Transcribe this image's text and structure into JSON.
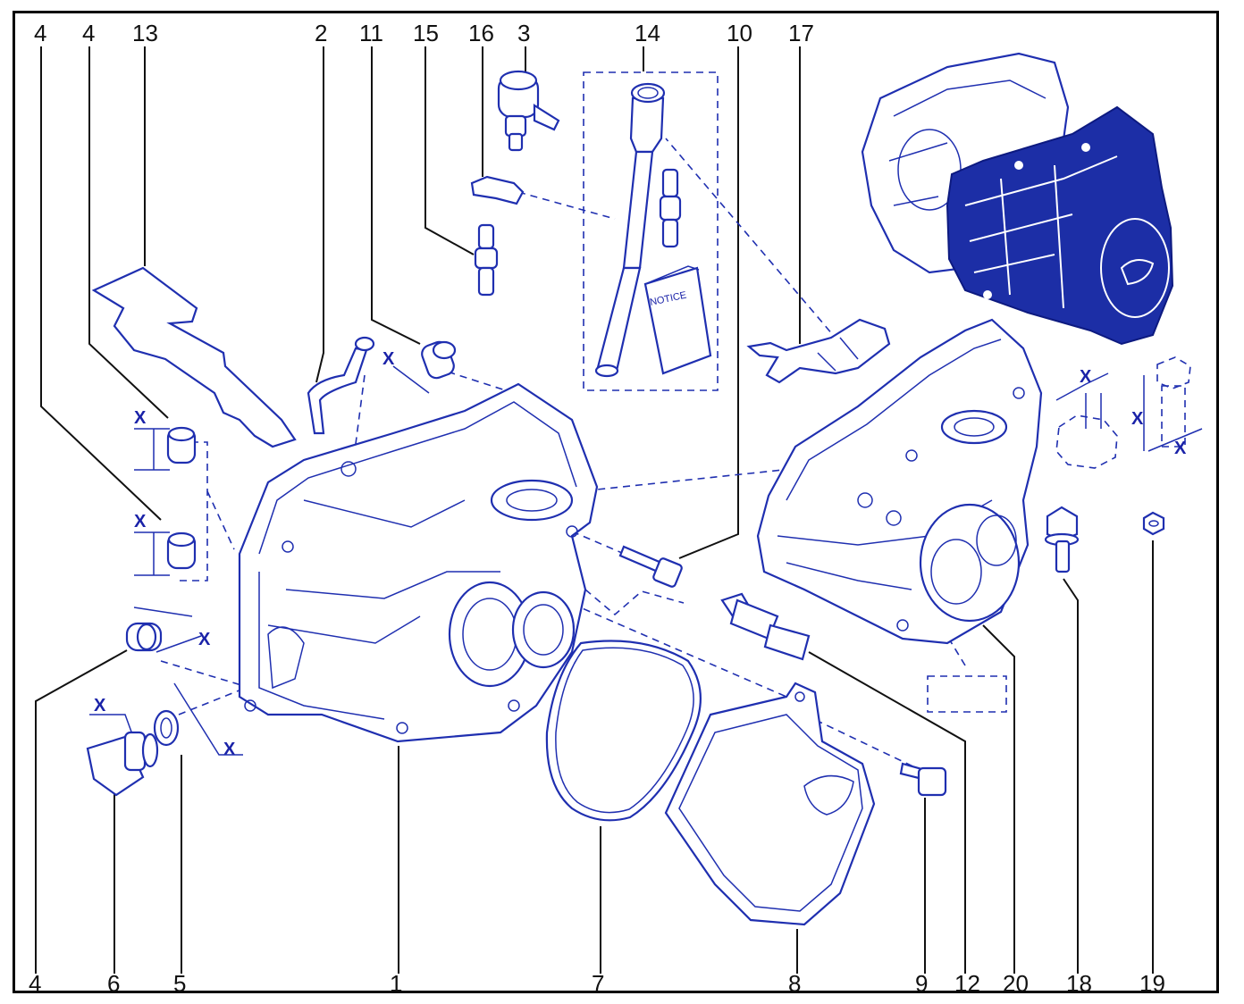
{
  "diagram": {
    "callouts": [
      "4",
      "4",
      "13",
      "2",
      "11",
      "15",
      "16",
      "3",
      "14",
      "10",
      "17"
    ],
    "bottom_callouts": [
      "4",
      "6",
      "5",
      "1",
      "7",
      "8",
      "9",
      "12",
      "20",
      "18",
      "19"
    ],
    "dimension_mark": "X",
    "notice_text": "NOTICE"
  },
  "colors": {
    "line": "#1f2fb0",
    "assembled": "#1c2ea6",
    "text": "#111111"
  }
}
